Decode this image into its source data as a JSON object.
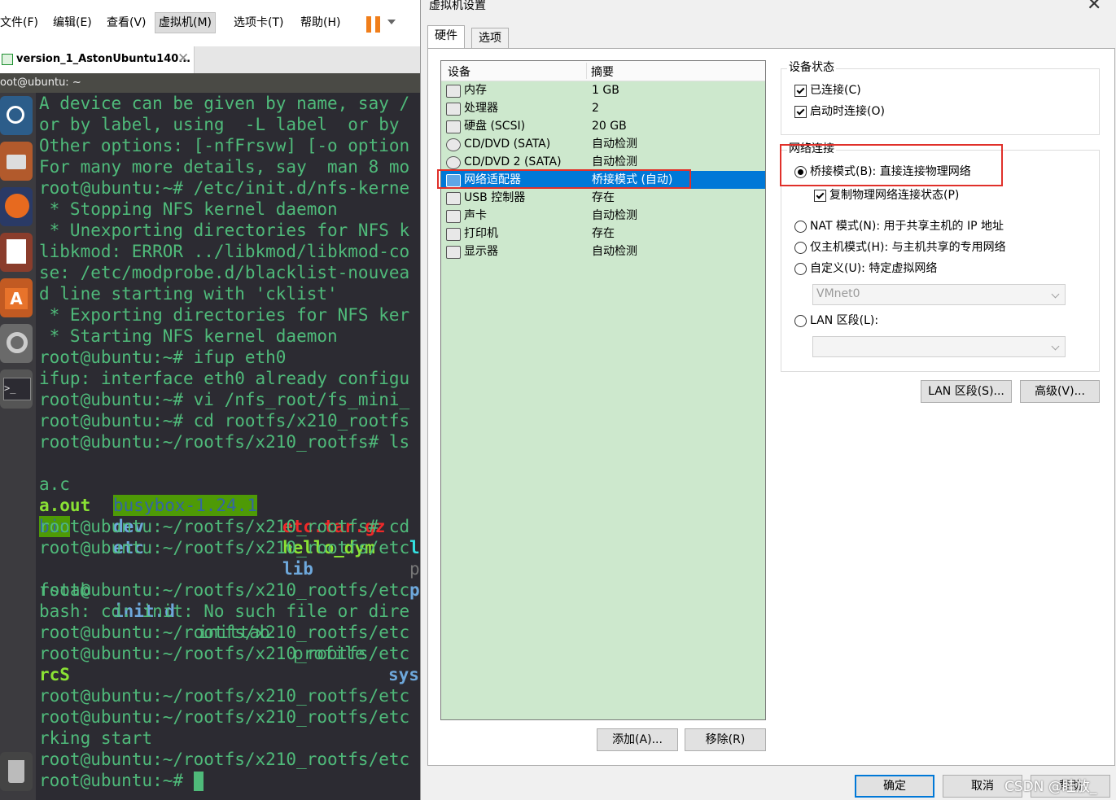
{
  "host": {
    "menu": [
      "文件(F)",
      "编辑(E)",
      "查看(V)",
      "虚拟机(M)",
      "选项卡(T)",
      "帮助(H)"
    ],
    "tab_title": "version_1_AstonUbuntu140...",
    "tab_close": "✕",
    "terminal_title": "oot@ubuntu: ~",
    "terminal_lines": [
      [
        "A device can be given by name, say /"
      ],
      [
        "or by label, using  -L label  or by "
      ],
      [
        "Other options: [-nfFrsvw] [-o option"
      ],
      [
        "For many more details, say  man 8 mo"
      ],
      [
        "root@ubuntu:~# /etc/init.d/nfs-kerne"
      ],
      [
        " * Stopping NFS kernel daemon"
      ],
      [
        " * Unexporting directories for NFS k"
      ],
      [
        "libkmod: ERROR ../libkmod/libkmod-co"
      ],
      [
        "se: /etc/modprobe.d/blacklist-nouvea"
      ],
      [
        "d line starting with 'cklist'"
      ],
      [
        " * Exporting directories for NFS ker"
      ],
      [
        " * Starting NFS kernel daemon"
      ],
      [
        "root@ubuntu:~# ifup eth0"
      ],
      [
        "ifup: interface eth0 already configu"
      ],
      [
        "root@ubuntu:~# vi /nfs_root/fs_mini_"
      ],
      [
        "root@ubuntu:~# cd rootfs/x210_rootfs"
      ],
      [
        "root@ubuntu:~/rootfs/x210_rootfs# ls"
      ],
      [
        "a.c",
        "busybox-1.24.1",
        "etc.tar.gz",
        "l"
      ],
      [
        "a.out",
        "dev",
        "hello_dym",
        "p"
      ],
      [
        "bin",
        "etc",
        "lib",
        "p"
      ],
      [
        "root@ubuntu:~/rootfs/x210_rootfs# cd"
      ],
      [
        "root@ubuntu:~/rootfs/x210_rootfs/etc"
      ],
      [
        "fstab",
        "init.d",
        "inittab",
        "profile",
        "sys"
      ],
      [
        "root@ubuntu:~/rootfs/x210_rootfs/etc"
      ],
      [
        "bash: cd: init: No such file or dire"
      ],
      [
        "root@ubuntu:~/rootfs/x210_rootfs/etc"
      ],
      [
        "root@ubuntu:~/rootfs/x210_rootfs/etc"
      ],
      [
        "rcS"
      ],
      [
        "root@ubuntu:~/rootfs/x210_rootfs/etc"
      ],
      [
        "root@ubuntu:~/rootfs/x210_rootfs/etc"
      ],
      [
        "rking start"
      ],
      [
        "root@ubuntu:~/rootfs/x210_rootfs/etc"
      ],
      [
        "root@ubuntu:~# "
      ]
    ]
  },
  "dialog": {
    "title": "虚拟机设置",
    "close": "✕",
    "tabs": [
      "硬件",
      "选项"
    ],
    "device_header": {
      "device": "设备",
      "summary": "摘要"
    },
    "devices": [
      {
        "icon": "memory-icon",
        "name": "内存",
        "summary": "1 GB"
      },
      {
        "icon": "processor-icon",
        "name": "处理器",
        "summary": "2"
      },
      {
        "icon": "harddisk-icon",
        "name": "硬盘 (SCSI)",
        "summary": "20 GB"
      },
      {
        "icon": "cdrom-icon",
        "name": "CD/DVD (SATA)",
        "summary": "自动检测"
      },
      {
        "icon": "cdrom-icon",
        "name": "CD/DVD 2 (SATA)",
        "summary": "自动检测"
      },
      {
        "icon": "network-adapter-icon",
        "name": "网络适配器",
        "summary": "桥接模式 (自动)"
      },
      {
        "icon": "usb-icon",
        "name": "USB 控制器",
        "summary": "存在"
      },
      {
        "icon": "sound-icon",
        "name": "声卡",
        "summary": "自动检测"
      },
      {
        "icon": "printer-icon",
        "name": "打印机",
        "summary": "存在"
      },
      {
        "icon": "display-icon",
        "name": "显示器",
        "summary": "自动检测"
      }
    ],
    "selected_device": 5,
    "add_button": "添加(A)...",
    "remove_button": "移除(R)",
    "device_status": {
      "title": "设备状态",
      "connected": "已连接(C)",
      "connect_on_start": "启动时连接(O)"
    },
    "network": {
      "title": "网络连接",
      "bridged": "桥接模式(B): 直接连接物理网络",
      "replicate": "复制物理网络连接状态(P)",
      "nat": "NAT 模式(N): 用于共享主机的 IP 地址",
      "host_only": "仅主机模式(H): 与主机共享的专用网络",
      "custom": "自定义(U): 特定虚拟网络",
      "custom_value": "VMnet0",
      "lan_segment": "LAN 区段(L):",
      "lan_value": ""
    },
    "lan_segments_button": "LAN 区段(S)...",
    "advanced_button": "高级(V)...",
    "ok_button": "确定",
    "cancel_button": "取消",
    "help_button": "帮助"
  },
  "watermark": "CSDN @眭放_",
  "colors": {
    "terminal_bg": "#2c2b32",
    "terminal_text": "#4fba7a",
    "list_bg": "#cde8cd",
    "selection": "#0078d7",
    "annotation_red": "#e0302a",
    "pause_orange": "#f07e1a"
  }
}
